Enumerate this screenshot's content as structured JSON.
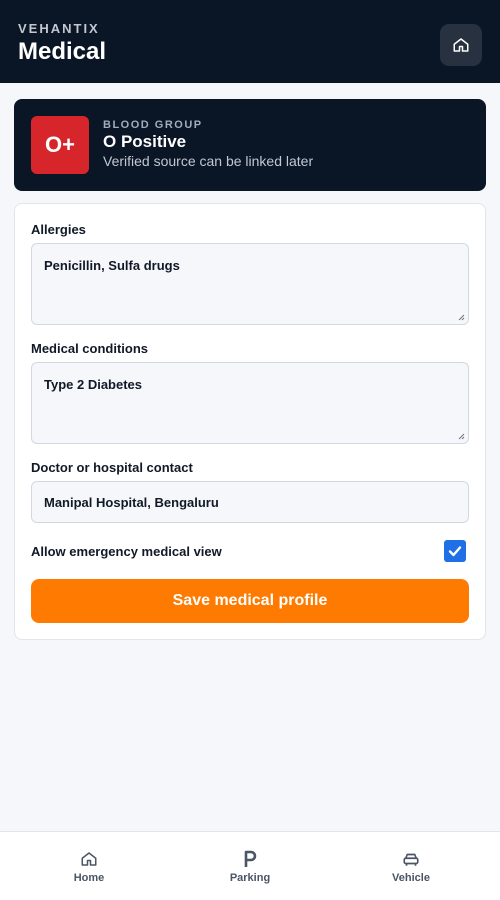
{
  "header": {
    "brand": "VEHANTIX",
    "title": "Medical",
    "home_icon": "home-icon"
  },
  "blood_group": {
    "badge": "O+",
    "label": "BLOOD GROUP",
    "value": "O Positive",
    "note": "Verified source can be linked later"
  },
  "form": {
    "allergies": {
      "label": "Allergies",
      "value": "Penicillin, Sulfa drugs"
    },
    "conditions": {
      "label": "Medical conditions",
      "value": "Type 2 Diabetes"
    },
    "contact": {
      "label": "Doctor or hospital contact",
      "value": "Manipal Hospital, Bengaluru"
    },
    "emergency_view": {
      "label": "Allow emergency medical view",
      "checked": true
    },
    "save_label": "Save medical profile"
  },
  "bottom_nav": {
    "items": [
      {
        "label": "Home",
        "icon": "home-icon"
      },
      {
        "label": "Parking",
        "icon": "parking-icon"
      },
      {
        "label": "Vehicle",
        "icon": "car-icon"
      }
    ]
  },
  "colors": {
    "header_bg": "#0a1526",
    "badge_red": "#d6262b",
    "accent_orange": "#ff7a00",
    "checkbox_blue": "#1f6fe5"
  }
}
